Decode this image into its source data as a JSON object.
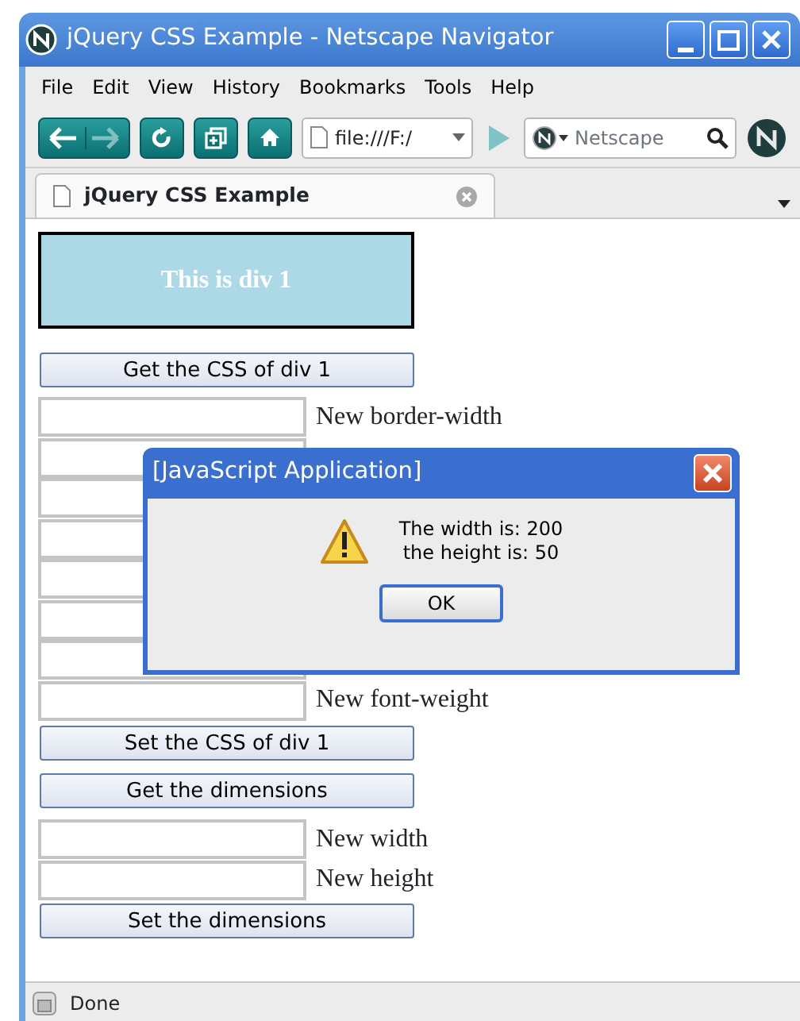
{
  "window": {
    "title": "jQuery CSS Example - Netscape Navigator"
  },
  "menu": [
    "File",
    "Edit",
    "View",
    "History",
    "Bookmarks",
    "Tools",
    "Help"
  ],
  "toolbar": {
    "address": "file:///F:/",
    "search": {
      "placeholder": "Netscape"
    }
  },
  "tabs": [
    {
      "label": "jQuery CSS Example",
      "selected": true
    }
  ],
  "page": {
    "div1": "This is div 1",
    "get_css_button": "Get the CSS of div 1",
    "css_fields": [
      {
        "kind": "labeled",
        "label": "New border-width"
      },
      {
        "kind": "covered"
      },
      {
        "kind": "covered"
      },
      {
        "kind": "covered"
      },
      {
        "kind": "covered"
      },
      {
        "kind": "covered"
      },
      {
        "kind": "covered"
      },
      {
        "kind": "labeled",
        "label": "New font-weight"
      }
    ],
    "set_css_button": "Set the CSS of div 1",
    "get_dimensions_button": "Get the dimensions",
    "dimension_fields": [
      {
        "kind": "labeled",
        "label": "New width"
      },
      {
        "kind": "labeled",
        "label": "New height"
      }
    ],
    "set_dimensions_button": "Set the dimensions"
  },
  "dialog": {
    "title": "[JavaScript Application]",
    "lines": [
      "The width is: 200",
      "the height is: 50"
    ],
    "button": "OK"
  },
  "status_bar": "Done"
}
